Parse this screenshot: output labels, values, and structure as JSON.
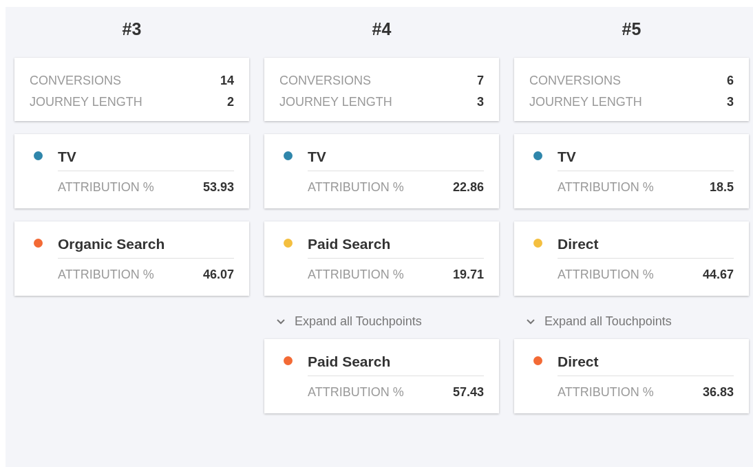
{
  "columns": [
    {
      "title": "#3",
      "stats": [
        {
          "label": "CONVERSIONS",
          "value": "14"
        },
        {
          "label": "JOURNEY LENGTH",
          "value": "2"
        }
      ],
      "touchpoints": [
        {
          "name": "TV",
          "color": "#2f86ab",
          "label": "ATTRIBUTION %",
          "value": "53.93"
        },
        {
          "name": "Organic Search",
          "color": "#f36a35",
          "label": "ATTRIBUTION %",
          "value": "46.07"
        }
      ]
    },
    {
      "title": "#4",
      "stats": [
        {
          "label": "CONVERSIONS",
          "value": "7"
        },
        {
          "label": "JOURNEY LENGTH",
          "value": "3"
        }
      ],
      "touchpoints": [
        {
          "name": "TV",
          "color": "#2f86ab",
          "label": "ATTRIBUTION %",
          "value": "22.86"
        },
        {
          "name": "Paid Search",
          "color": "#f4bf3f",
          "label": "ATTRIBUTION %",
          "value": "19.71"
        }
      ],
      "expand": {
        "label": "Expand all Touchpoints"
      },
      "more_touchpoints": [
        {
          "name": "Paid Search",
          "color": "#f36a35",
          "label": "ATTRIBUTION %",
          "value": "57.43"
        }
      ]
    },
    {
      "title": "#5",
      "stats": [
        {
          "label": "CONVERSIONS",
          "value": "6"
        },
        {
          "label": "JOURNEY LENGTH",
          "value": "3"
        }
      ],
      "touchpoints": [
        {
          "name": "TV",
          "color": "#2f86ab",
          "label": "ATTRIBUTION %",
          "value": "18.5"
        },
        {
          "name": "Direct",
          "color": "#f4bf3f",
          "label": "ATTRIBUTION %",
          "value": "44.67"
        }
      ],
      "expand": {
        "label": "Expand all Touchpoints"
      },
      "more_touchpoints": [
        {
          "name": "Direct",
          "color": "#f36a35",
          "label": "ATTRIBUTION %",
          "value": "36.83"
        }
      ]
    }
  ]
}
